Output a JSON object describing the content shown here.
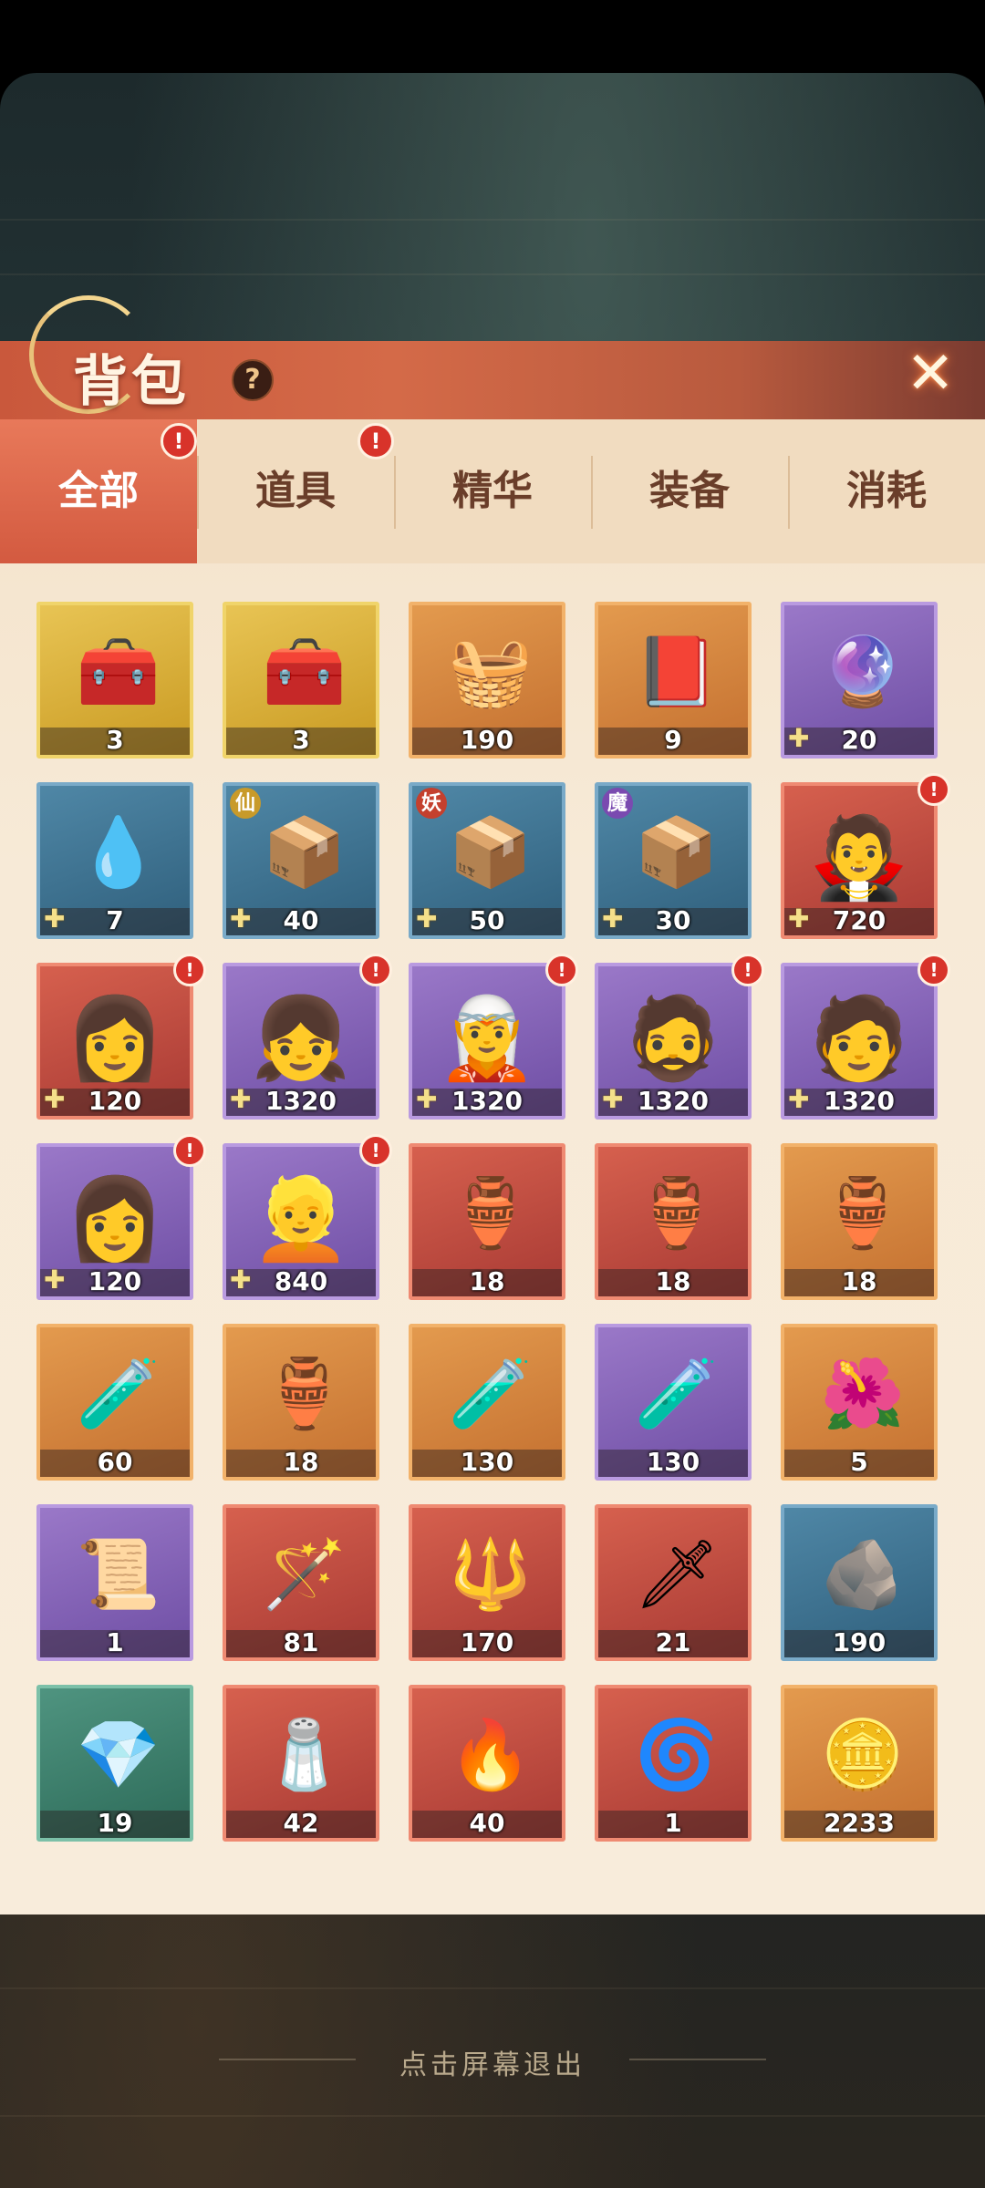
{
  "header": {
    "title": "背包",
    "help_glyph": "?",
    "close_glyph": "✕"
  },
  "tabs": [
    {
      "label": "全部",
      "active": true,
      "alert": "!"
    },
    {
      "label": "道具",
      "active": false,
      "alert": "!"
    },
    {
      "label": "精华",
      "active": false
    },
    {
      "label": "装备",
      "active": false
    },
    {
      "label": "消耗",
      "active": false
    }
  ],
  "items": [
    {
      "rarity": "gold",
      "icon": "🧰",
      "count": "3"
    },
    {
      "rarity": "gold",
      "icon": "🧰",
      "count": "3"
    },
    {
      "rarity": "orange",
      "icon": "🧺",
      "count": "190"
    },
    {
      "rarity": "orange",
      "icon": "📕",
      "count": "9"
    },
    {
      "rarity": "purple",
      "icon": "🔮",
      "count": "20",
      "fragment": true
    },
    {
      "rarity": "blue",
      "icon": "💧",
      "count": "7",
      "fragment": true
    },
    {
      "rarity": "blue",
      "icon": "📦",
      "count": "40",
      "fragment": true,
      "tag": "仙",
      "tag_color": "#c89a2a"
    },
    {
      "rarity": "blue",
      "icon": "📦",
      "count": "50",
      "fragment": true,
      "tag": "妖",
      "tag_color": "#c4402e"
    },
    {
      "rarity": "blue",
      "icon": "📦",
      "count": "30",
      "fragment": true,
      "tag": "魔",
      "tag_color": "#7a4ab0"
    },
    {
      "rarity": "red",
      "icon": "🧛",
      "count": "720",
      "fragment": true,
      "portrait": true,
      "alert": "!"
    },
    {
      "rarity": "red",
      "icon": "👩",
      "count": "120",
      "fragment": true,
      "portrait": true,
      "alert": "!"
    },
    {
      "rarity": "purple",
      "icon": "👧",
      "count": "1320",
      "fragment": true,
      "portrait": true,
      "alert": "!"
    },
    {
      "rarity": "purple",
      "icon": "🧝",
      "count": "1320",
      "fragment": true,
      "portrait": true,
      "alert": "!"
    },
    {
      "rarity": "purple",
      "icon": "🧔",
      "count": "1320",
      "fragment": true,
      "portrait": true,
      "alert": "!"
    },
    {
      "rarity": "purple",
      "icon": "🧑",
      "count": "1320",
      "fragment": true,
      "portrait": true,
      "alert": "!"
    },
    {
      "rarity": "purple",
      "icon": "👩",
      "count": "120",
      "fragment": true,
      "portrait": true,
      "alert": "!"
    },
    {
      "rarity": "purple",
      "icon": "👱",
      "count": "840",
      "fragment": true,
      "portrait": true,
      "alert": "!"
    },
    {
      "rarity": "red",
      "icon": "🏺",
      "count": "18"
    },
    {
      "rarity": "red",
      "icon": "🏺",
      "count": "18"
    },
    {
      "rarity": "orange",
      "icon": "🏺",
      "count": "18"
    },
    {
      "rarity": "orange",
      "icon": "🧪",
      "count": "60"
    },
    {
      "rarity": "orange",
      "icon": "🏺",
      "count": "18"
    },
    {
      "rarity": "orange",
      "icon": "🧪",
      "count": "130"
    },
    {
      "rarity": "purple",
      "icon": "🧪",
      "count": "130"
    },
    {
      "rarity": "orange",
      "icon": "🌺",
      "count": "5"
    },
    {
      "rarity": "purple",
      "icon": "📜",
      "count": "1"
    },
    {
      "rarity": "red",
      "icon": "🪄",
      "count": "81"
    },
    {
      "rarity": "red",
      "icon": "🔱",
      "count": "170"
    },
    {
      "rarity": "red",
      "icon": "🗡",
      "count": "21"
    },
    {
      "rarity": "blue",
      "icon": "🪨",
      "count": "190"
    },
    {
      "rarity": "green",
      "icon": "💎",
      "count": "19"
    },
    {
      "rarity": "red",
      "icon": "🧂",
      "count": "42"
    },
    {
      "rarity": "red",
      "icon": "🔥",
      "count": "40"
    },
    {
      "rarity": "red",
      "icon": "🌀",
      "count": "1"
    },
    {
      "rarity": "orange",
      "icon": "🪙",
      "count": "2233"
    }
  ],
  "footer": {
    "exit_hint": "点击屏幕退出"
  }
}
